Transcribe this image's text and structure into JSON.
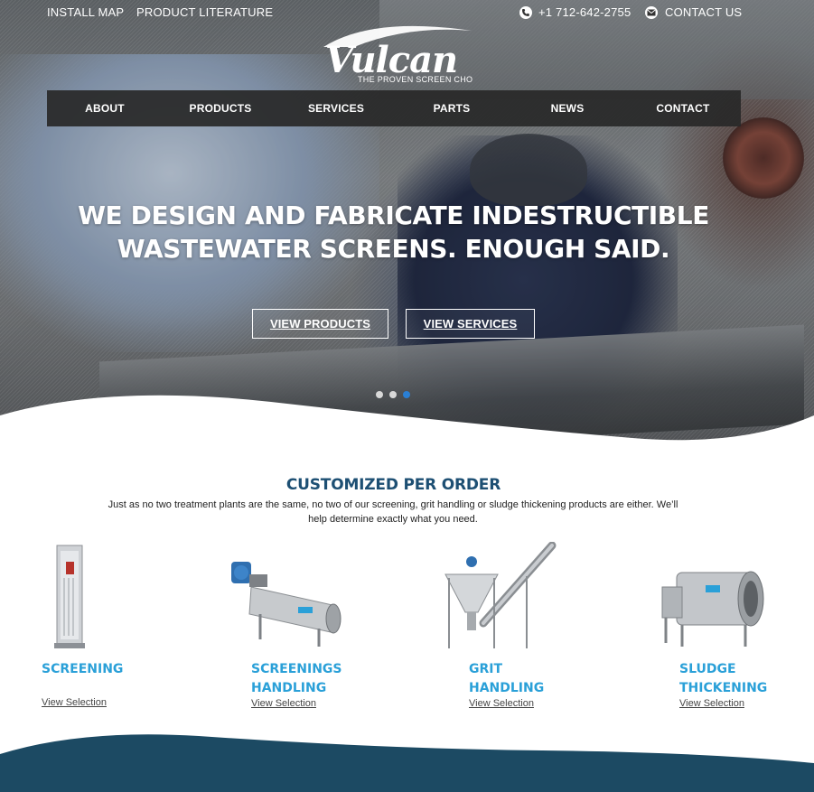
{
  "topbar": {
    "install_map": "INSTALL MAP",
    "product_literature": "PRODUCT LITERATURE",
    "phone": "+1 712-642-2755",
    "contact": "CONTACT US"
  },
  "logo": {
    "name": "Vulcan",
    "tagline": "THE PROVEN SCREEN CHOICE"
  },
  "nav": {
    "items": [
      {
        "label": "ABOUT"
      },
      {
        "label": "PRODUCTS"
      },
      {
        "label": "SERVICES"
      },
      {
        "label": "PARTS"
      },
      {
        "label": "NEWS"
      },
      {
        "label": "CONTACT"
      }
    ]
  },
  "hero": {
    "headline_line1": "WE DESIGN AND FABRICATE INDESTRUCTIBLE",
    "headline_line2": "WASTEWATER SCREENS. ENOUGH SAID.",
    "btn_products": "VIEW PRODUCTS",
    "btn_services": "VIEW SERVICES",
    "slide_count": 3,
    "active_slide": 3
  },
  "section": {
    "title": "CUSTOMIZED PER ORDER",
    "description": "Just as no two treatment plants are the same, no two of our screening, grit handling or sludge thickening products are either. We’ll help determine exactly what you need."
  },
  "products": [
    {
      "name_line1": "SCREENING",
      "name_line2": "",
      "link": "View Selection"
    },
    {
      "name_line1": "SCREENINGS",
      "name_line2": "HANDLING",
      "link": "View Selection"
    },
    {
      "name_line1": "GRIT",
      "name_line2": "HANDLING",
      "link": "View Selection"
    },
    {
      "name_line1": "SLUDGE",
      "name_line2": "THICKENING",
      "link": "View Selection"
    }
  ],
  "colors": {
    "accent_blue": "#2aa0d8",
    "title_navy": "#1d4f73",
    "footer_navy": "#1c4a63",
    "active_dot": "#2a7fd4"
  }
}
